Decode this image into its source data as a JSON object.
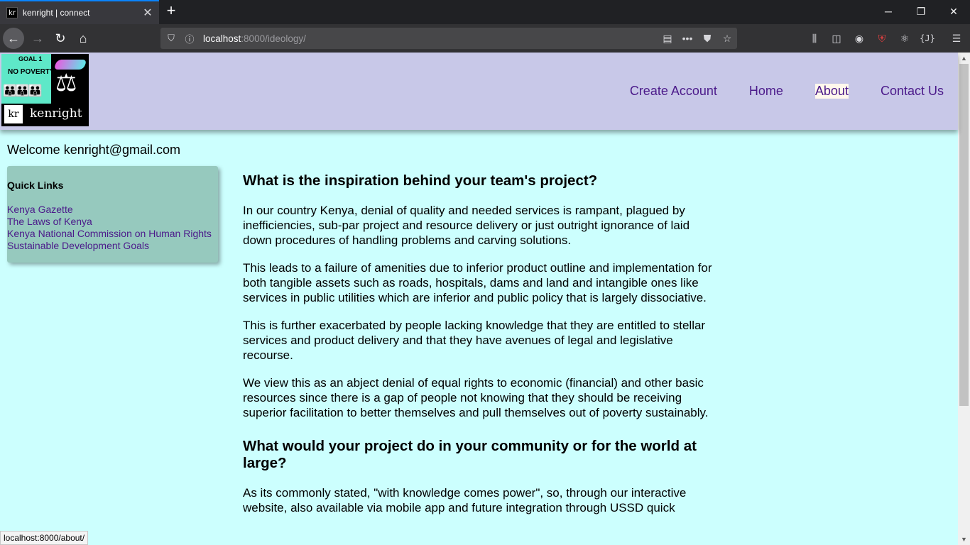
{
  "browser": {
    "tab_favicon": "kr",
    "tab_title": "kenright | connect",
    "url_host": "localhost",
    "url_rest": ":8000/ideology/",
    "status_url": "localhost:8000/about/"
  },
  "logo": {
    "goal": "GOAL 1",
    "no_poverty": "NO POVERTY",
    "kr": "kr",
    "name": "kenright"
  },
  "nav": {
    "items": [
      {
        "label": "Create Account"
      },
      {
        "label": "Home"
      },
      {
        "label": "About"
      },
      {
        "label": "Contact Us"
      }
    ],
    "active": "About"
  },
  "welcome": "Welcome kenright@gmail.com",
  "quick_links": {
    "title": "Quick Links",
    "items": [
      {
        "label": "Kenya Gazette"
      },
      {
        "label": "The Laws of Kenya"
      },
      {
        "label": "Kenya National Commission on Human Rights"
      },
      {
        "label": "Sustainable Development Goals"
      }
    ]
  },
  "content": {
    "heading1": "What is the inspiration behind your team's project?",
    "paragraphs": [
      "In our country Kenya, denial of quality and needed services is rampant, plagued by inefficiencies, sub-par project and resource delivery or just outright ignorance of laid down procedures of handling problems and carving solutions.",
      "This leads to a failure of amenities due to inferior product outline and implementation for both tangible assets such as roads, hospitals, dams and land and intangible ones like services in public utilities which are inferior and public policy that is largely dissociative.",
      "This is further exacerbated by people lacking knowledge that they are entitled to stellar services and product delivery and that they have avenues of legal and legislative recourse.",
      "We view this as an abject denial of equal rights to economic (financial) and other basic resources since there is a gap of people not knowing that they should be receiving superior facilitation to better themselves and pull themselves out of poverty sustainably."
    ],
    "heading2": "What would your project do in your community or for the world at large?",
    "paragraph_last": "As its commonly stated, \"with knowledge comes power\", so, through our interactive website, also available via mobile app and future integration through USSD quick"
  },
  "colors": {
    "page_bg": "#ccfffe",
    "header_bg": "#c8c8e8",
    "link": "#4b1a8a",
    "quick_links_bg": "#96c9be"
  }
}
